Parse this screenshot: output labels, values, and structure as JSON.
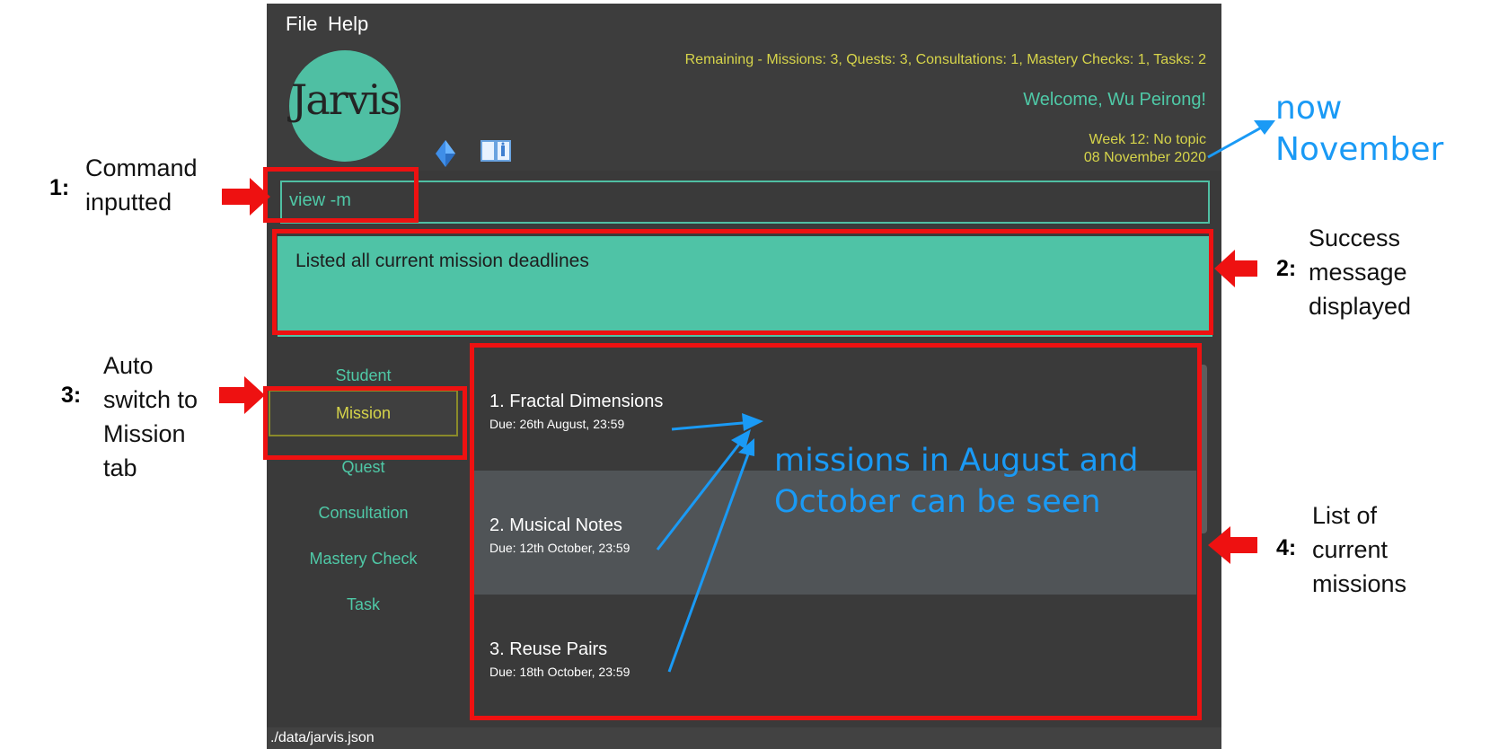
{
  "menu": {
    "file": "File",
    "help": "Help"
  },
  "header": {
    "logo": "Jarvis",
    "remaining": "Remaining - Missions: 3, Quests: 3, Consultations: 1, Mastery Checks: 1, Tasks: 2",
    "welcome": "Welcome, Wu Peirong!",
    "week_prefix": "Week 12: ",
    "week_topic": "No topic",
    "date": "08 November 2020"
  },
  "command": {
    "value": "view -m"
  },
  "result": {
    "message": "Listed all current mission deadlines"
  },
  "tabs": [
    "Student",
    "Mission",
    "Quest",
    "Consultation",
    "Mastery Check",
    "Task"
  ],
  "active_tab": "Mission",
  "missions": [
    {
      "title": "1.  Fractal Dimensions",
      "due": "Due: 26th August, 23:59"
    },
    {
      "title": "2.  Musical Notes",
      "due": "Due: 12th October, 23:59"
    },
    {
      "title": "3.  Reuse Pairs",
      "due": "Due: 18th October, 23:59"
    }
  ],
  "status_bar": {
    "path": "./data/jarvis.json"
  },
  "annotations": {
    "n1": "1:",
    "t1": [
      "Command",
      "inputted"
    ],
    "n2": "2:",
    "t2": [
      "Success",
      "message",
      "displayed"
    ],
    "n3": "3:",
    "t3": [
      "Auto",
      "switch to",
      "Mission",
      "tab"
    ],
    "n4": "4:",
    "t4": [
      "List of",
      "current",
      "missions"
    ],
    "note_month": [
      "now",
      "November"
    ],
    "note_missions": [
      "missions in August and",
      "October can be seen"
    ]
  },
  "colors": {
    "accent_teal": "#4fc3a6",
    "accent_yellow": "#d6d44a",
    "annotation_red": "#ee1111",
    "annotation_blue": "#1a9af5",
    "app_bg": "#3a3a3a"
  }
}
